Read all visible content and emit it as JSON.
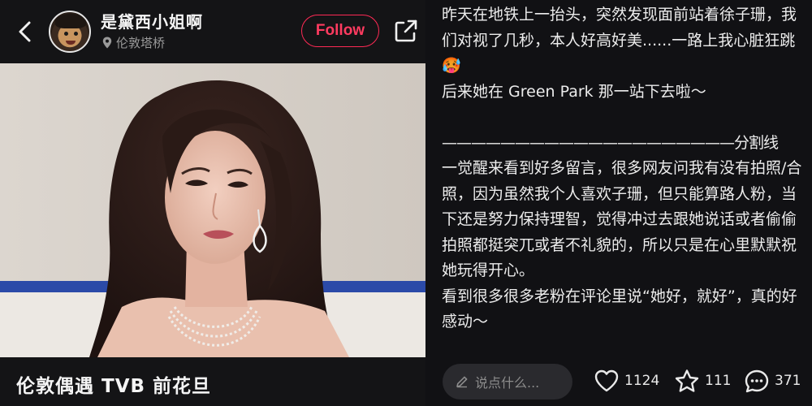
{
  "header": {
    "username": "是黛西小姐啊",
    "location": "伦敦塔桥",
    "follow_label": "Follow"
  },
  "post": {
    "title": "伦敦偶遇 TVB 前花旦",
    "paragraphs": [
      "昨天在地铁上一抬头，突然发现面前站着徐子珊，我们对视了几秒，本人好高好美......一路上我心脏狂跳🥵",
      "后来她在 Green Park 那一站下去啦～",
      "",
      "————————————————————分割线",
      "一觉醒来看到好多留言，很多网友问我有没有拍照/合照，因为虽然我个人喜欢子珊，但只能算路人粉，当下还是努力保持理智，觉得冲过去跟她说话或者偷偷拍照都挺突兀或者不礼貌的，所以只是在心里默默祝她玩得开心。",
      "看到很多很多老粉在评论里说“她好，就好”，真的好感动～"
    ]
  },
  "actions": {
    "comment_placeholder": "说点什么...",
    "likes": "1124",
    "favorites": "111",
    "comments": "371"
  },
  "colors": {
    "accent": "#ff2a55",
    "background": "#111114"
  },
  "icons": [
    "back-arrow-icon",
    "location-pin-icon",
    "share-icon",
    "pencil-icon",
    "heart-icon",
    "star-icon",
    "comment-bubble-icon"
  ]
}
